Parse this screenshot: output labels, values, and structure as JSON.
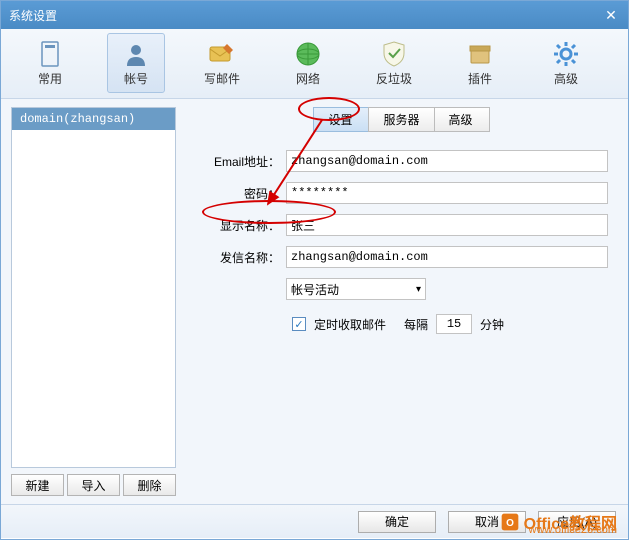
{
  "window": {
    "title": "系统设置"
  },
  "toolbar": {
    "items": [
      {
        "label": "常用"
      },
      {
        "label": "帐号"
      },
      {
        "label": "写邮件"
      },
      {
        "label": "网络"
      },
      {
        "label": "反垃圾"
      },
      {
        "label": "插件"
      },
      {
        "label": "高级"
      }
    ]
  },
  "sidebar": {
    "account": "domain(zhangsan)",
    "buttons": {
      "new": "新建",
      "import": "导入",
      "delete": "删除"
    }
  },
  "tabs": {
    "settings": "设置",
    "server": "服务器",
    "advanced": "高级"
  },
  "form": {
    "email_label": "Email地址：",
    "email_value": "zhangsan@domain.com",
    "password_label": "密码：",
    "password_value": "********",
    "display_label": "显示名称：",
    "display_value": "张三",
    "sender_label": "发信名称：",
    "sender_value": "zhangsan@domain.com",
    "select_value": "帐号活动",
    "checkbox_label": "定时收取邮件",
    "interval_prefix": "每隔",
    "interval_value": "15",
    "interval_suffix": "分钟"
  },
  "footer": {
    "ok": "确定",
    "cancel": "取消",
    "apply": "应用(A)"
  },
  "watermark": {
    "brand": "Office教程网",
    "url": "www.office26.com"
  }
}
